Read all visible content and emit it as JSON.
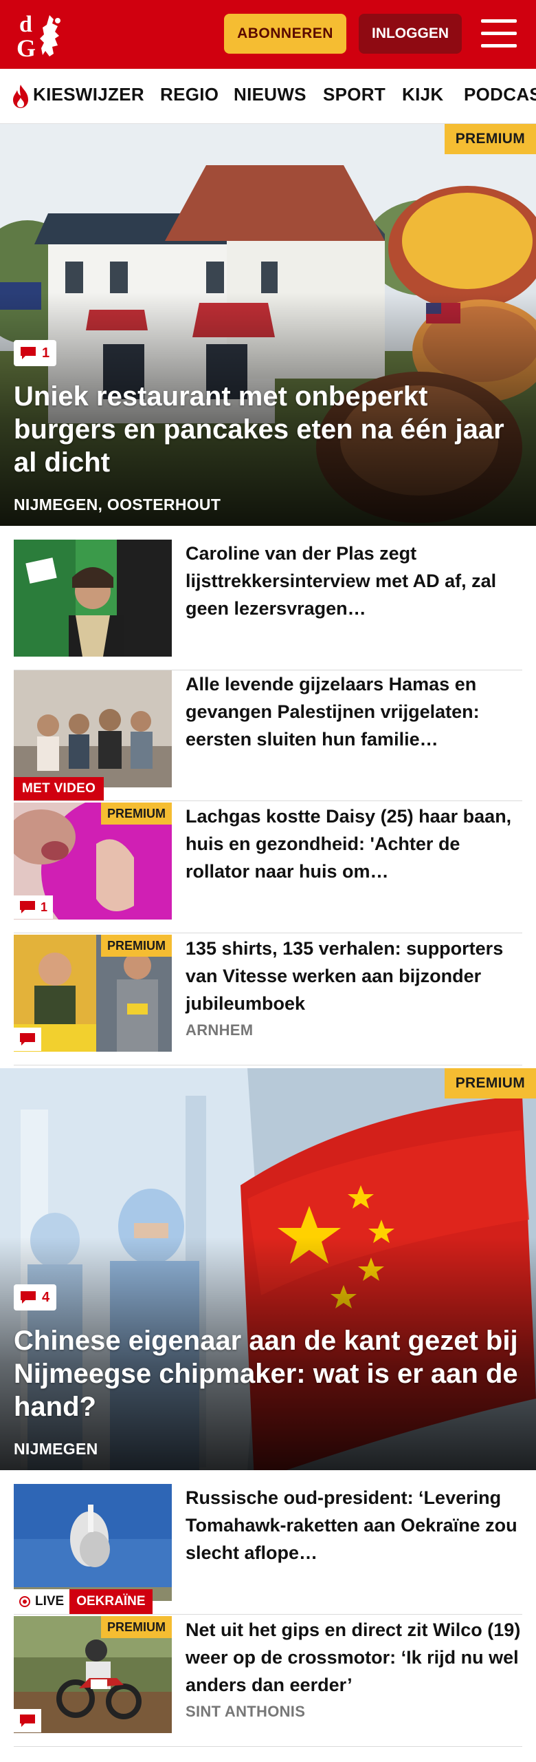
{
  "header": {
    "logo_text": "dG",
    "subscribe_label": "ABONNEREN",
    "login_label": "INLOGGEN",
    "menu_icon": "hamburger-menu-icon",
    "brand_color": "#d0000f"
  },
  "nav": {
    "items": [
      "KIESWIJZER",
      "REGIO",
      "NIEUWS",
      "SPORT",
      "KIJK",
      "PODCAST"
    ]
  },
  "hero1": {
    "premium_label": "PREMIUM",
    "comments": "1",
    "title": "Uniek restaurant met onbeperkt burgers en pancakes eten na één jaar al dicht",
    "location": "NIJMEGEN, OOSTERHOUT"
  },
  "articles": [
    {
      "title": "Caroline van der Plas zegt lijsttrekkersinterview met AD af, zal geen lezersvragen…"
    },
    {
      "title": "Alle levende gijzelaars Hamas en gevangen Palestijnen vrijgela­ten: eersten sluiten hun familie…",
      "video_label": "MET VIDEO"
    },
    {
      "title": "Lachgas kostte Daisy (25) haar baan, huis en gezondheid: 'Achter de rollator naar huis om…",
      "premium_label": "PREMIUM",
      "comments": "1"
    },
    {
      "title": "135 shirts, 135 verhalen: supporters van Vitesse werken aan bijzonder jubileumboek",
      "premium_label": "PREMIUM",
      "location": "ARNHEM"
    }
  ],
  "hero2": {
    "premium_label": "PREMIUM",
    "comments": "4",
    "title": "Chinese eigenaar aan de kant gezet bij Nijmeegse chipmaker: wat is er aan de hand?",
    "location": "NIJMEGEN"
  },
  "articles2": [
    {
      "title": "Russische oud-president: ‘Levering Tomahawk-raketten aan Oekraïne zou slecht aflope…",
      "live_label": "LIVE",
      "topic_label": "OEKRAÏNE"
    },
    {
      "title": "Net uit het gips en direct zit Wilco (19) weer op de crossmotor: ‘Ik rijd nu wel anders dan eerder’",
      "premium_label": "PREMIUM",
      "location": "SINT ANTHONIS"
    }
  ]
}
